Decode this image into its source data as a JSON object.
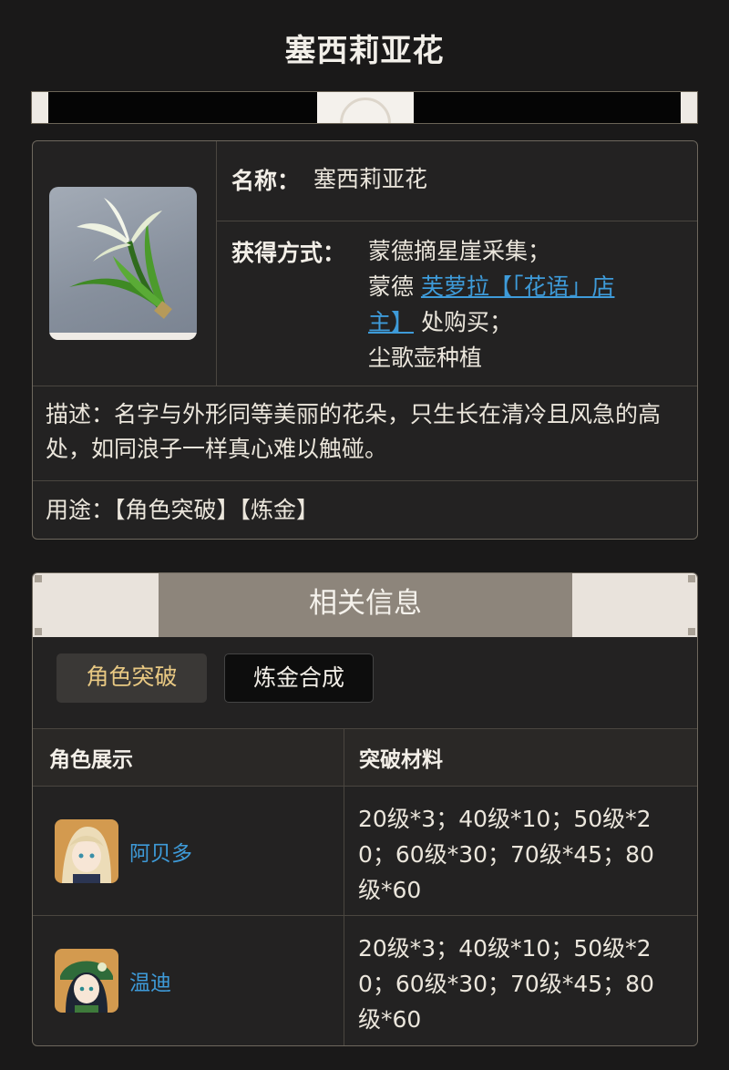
{
  "page": {
    "title": "塞西莉亚花"
  },
  "item": {
    "name_label": "名称：",
    "name": "塞西莉亚花",
    "obtain_label": "获得方式：",
    "obtain_line1": "蒙德摘星崖采集；",
    "obtain_line2_prefix": "蒙德 ",
    "obtain_link_a": "芙萝拉【「花语」店",
    "obtain_link_b": "主】",
    "obtain_line3_suffix": " 处购买；",
    "obtain_line4": "尘歌壶种植",
    "description": "描述：名字与外形同等美丽的花朵，只生长在清冷且风急的高处，如同浪子一样真心难以触碰。",
    "usage": "用途：【角色突破】【炼金】"
  },
  "related": {
    "header": "相关信息",
    "tabs": [
      {
        "label": "角色突破",
        "active": true
      },
      {
        "label": "炼金合成",
        "active": false
      }
    ],
    "columns": [
      "角色展示",
      "突破材料"
    ],
    "rows": [
      {
        "name": "阿贝多",
        "materials": "20级*3；40级*10；50级*20；60级*30；70级*45；80级*60"
      },
      {
        "name": "温迪",
        "materials": "20级*3；40级*10；50级*20；60级*30；70级*45；80级*60"
      }
    ]
  },
  "colors": {
    "accent_link": "#3e9bd9",
    "active_tab_text": "#e9c983",
    "background": "#1a1919"
  }
}
